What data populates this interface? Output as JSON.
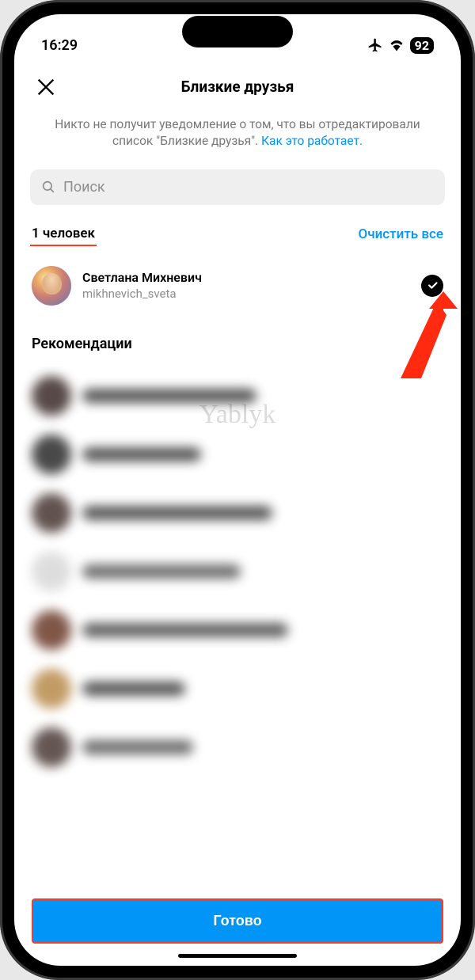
{
  "status": {
    "time": "16:29",
    "battery": "92"
  },
  "header": {
    "title": "Близкие друзья"
  },
  "info": {
    "text_part1": "Никто не получит уведомление о том, что вы отредактировали список \"Близкие друзья\". ",
    "link": "Как это работает."
  },
  "search": {
    "placeholder": "Поиск"
  },
  "count": {
    "label": "1 человек",
    "clear": "Очистить все"
  },
  "friend": {
    "name": "Светлана Михневич",
    "username": "mikhnevich_sveta"
  },
  "recommendations": {
    "title": "Рекомендации",
    "items": [
      {
        "avatar_color": "#3a2a28",
        "name_width": 220,
        "name_color": "#3a3a3a"
      },
      {
        "avatar_color": "#2a2a2a",
        "name_width": 150,
        "name_color": "#3a3a3a"
      },
      {
        "avatar_color": "#463530",
        "name_width": 240,
        "name_color": "#3a3a3a"
      },
      {
        "avatar_color": "#d8d8d8",
        "name_width": 200,
        "name_color": "#555"
      },
      {
        "avatar_color": "#6a3a28",
        "name_width": 260,
        "name_color": "#444"
      },
      {
        "avatar_color": "#b88a4a",
        "name_width": 130,
        "name_color": "#3a3a3a"
      },
      {
        "avatar_color": "#4a3a35",
        "name_width": 140,
        "name_color": "#555"
      }
    ]
  },
  "watermark": "Yablyk",
  "done": {
    "label": "Готово"
  }
}
